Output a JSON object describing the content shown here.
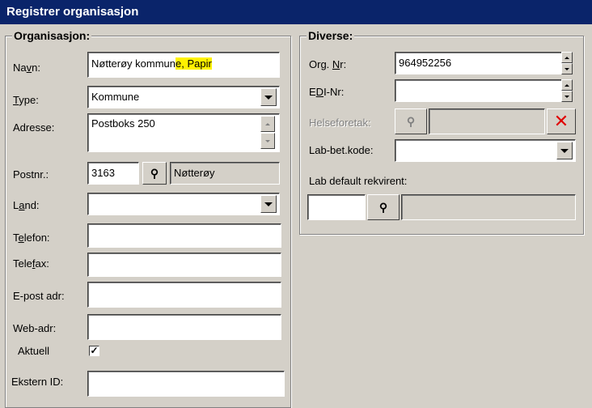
{
  "window": {
    "title": "Registrer organisasjon"
  },
  "organisasjon": {
    "group_title": "Organisasjon:",
    "navn_label_pre": "Na",
    "navn_label_u": "v",
    "navn_label_post": "n:",
    "navn_value_main": "Nøtterøy kommun",
    "navn_value_highlight": "e, Papir",
    "type_label_u": "T",
    "type_label_post": "ype:",
    "type_value": "Kommune",
    "adresse_label": "Adresse:",
    "adresse_value": "Postboks 250",
    "postnr_label": "Postnr.:",
    "postnr_value": "3163",
    "poststed_value": "Nøtterøy",
    "land_label_pre": "L",
    "land_label_u": "a",
    "land_label_post": "nd:",
    "land_value": "",
    "telefon_label_pre": "T",
    "telefon_label_u": "e",
    "telefon_label_post": "lefon:",
    "telefon_value": "",
    "telefax_label_pre": "Tele",
    "telefax_label_u": "f",
    "telefax_label_post": "ax:",
    "telefax_value": "",
    "epost_label": "E-post adr:",
    "epost_value": "",
    "web_label": "Web-adr:",
    "web_value": "",
    "aktuell_label": "Aktuell",
    "aktuell_checked": "✓",
    "ekstern_label": "Ekstern ID:",
    "ekstern_value": ""
  },
  "diverse": {
    "group_title": "Diverse:",
    "orgnr_label_pre": "Org. ",
    "orgnr_label_u": "N",
    "orgnr_label_post": "r:",
    "orgnr_value": "964952256",
    "edi_label_pre": "E",
    "edi_label_u": "D",
    "edi_label_post": "I-Nr:",
    "edi_value": "",
    "helseforetak_label": "Helseforetak:",
    "helseforetak_value": "",
    "labbet_label": "Lab-bet.kode:",
    "labbet_value": "",
    "labdefault_label": "Lab default rekvirent:",
    "labdefault_code": "",
    "labdefault_name": ""
  },
  "icons": {
    "binoculars": "⚲",
    "clear": "✕"
  }
}
